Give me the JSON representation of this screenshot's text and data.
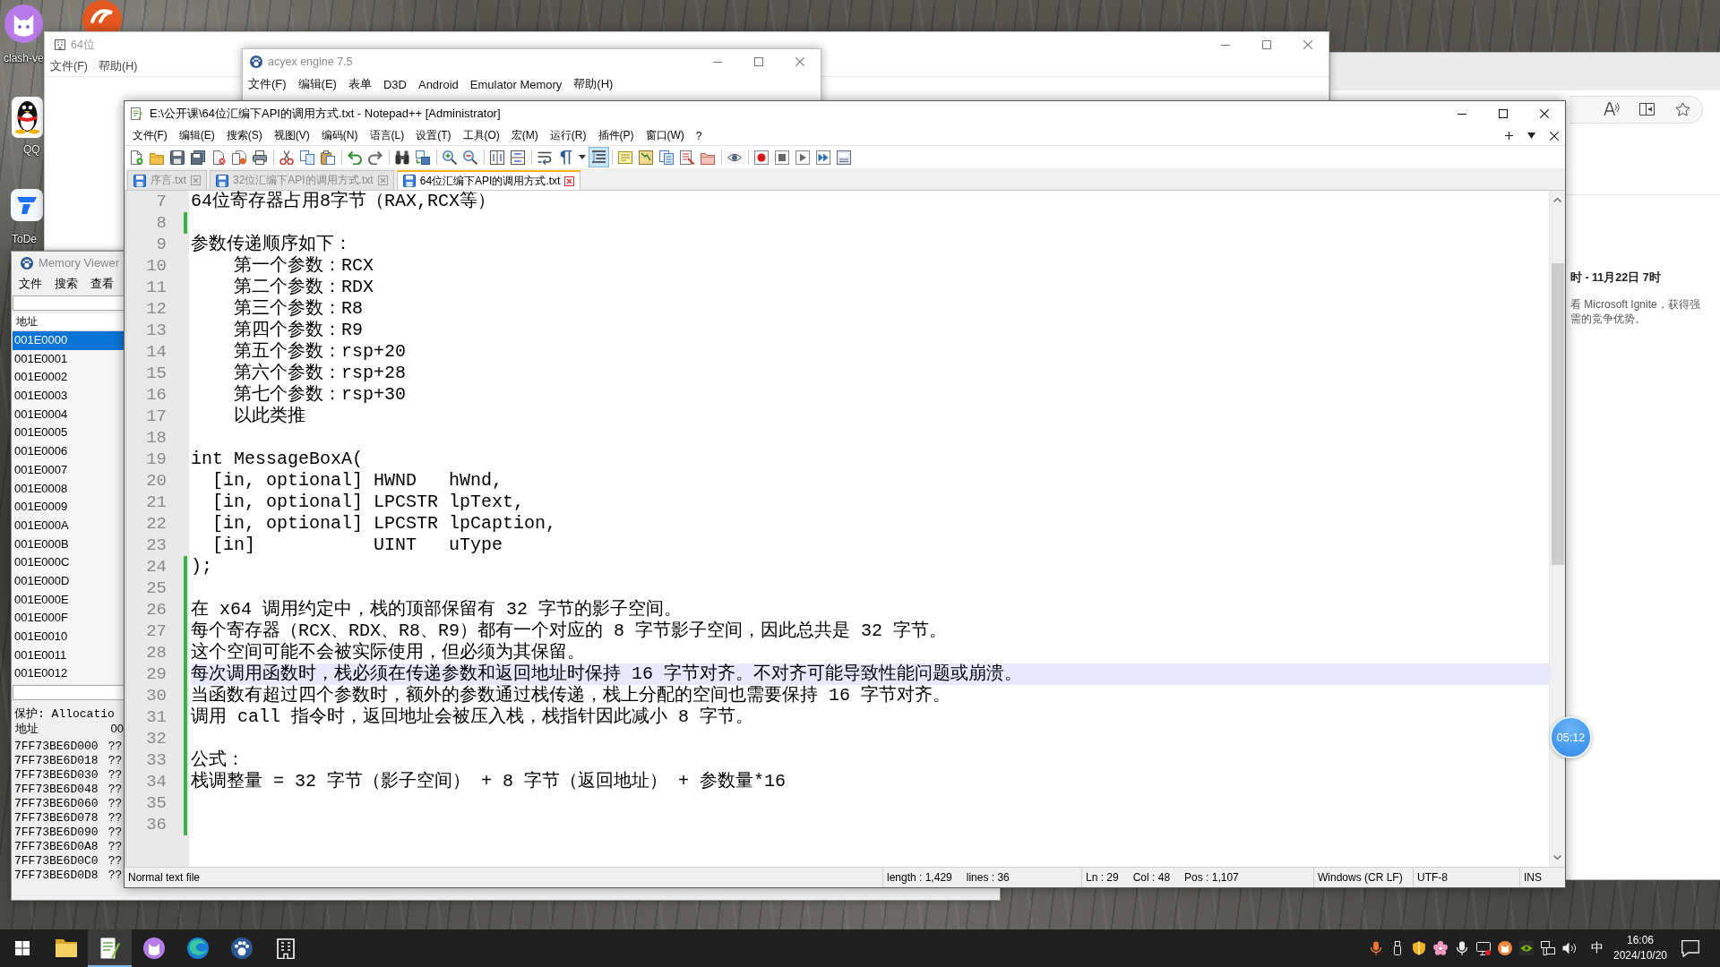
{
  "desktop_icons": [
    {
      "kind": "cat",
      "label": "clash-ve"
    },
    {
      "kind": "swirl"
    },
    {
      "kind": "penguin",
      "label": "QQ"
    },
    {
      "kind": "tile",
      "label": "ToDe"
    }
  ],
  "back_window": {
    "title": "64位",
    "menu": [
      "文件(F)",
      "帮助(H)"
    ]
  },
  "engine_window": {
    "title": "acyex engine 7.5",
    "menu": [
      "文件(F)",
      "编辑(E)",
      "表单",
      "D3D",
      "Android",
      "Emulator Memory",
      "帮助(H)"
    ]
  },
  "browser": {
    "event_title": "时 - 11月22日 7时",
    "event_lines": [
      "看 Microsoft Ignite，获得强",
      "需的竞争优势。"
    ]
  },
  "memory_viewer": {
    "title": "Memory Viewer",
    "menu": [
      "文件",
      "搜索",
      "查看"
    ],
    "list_header": "地址",
    "addresses": [
      {
        "address": "001E0000",
        "selected": true
      },
      {
        "address": "001E0001",
        "selected": false
      },
      {
        "address": "001E0002",
        "selected": false
      },
      {
        "address": "001E0003",
        "selected": false
      },
      {
        "address": "001E0004",
        "selected": false
      },
      {
        "address": "001E0005",
        "selected": false
      },
      {
        "address": "001E0006",
        "selected": false
      },
      {
        "address": "001E0007",
        "selected": false
      },
      {
        "address": "001E0008",
        "selected": false
      },
      {
        "address": "001E0009",
        "selected": false
      },
      {
        "address": "001E000A",
        "selected": false
      },
      {
        "address": "001E000B",
        "selected": false
      },
      {
        "address": "001E000C",
        "selected": false
      },
      {
        "address": "001E000D",
        "selected": false
      },
      {
        "address": "001E000E",
        "selected": false
      },
      {
        "address": "001E000F",
        "selected": false
      },
      {
        "address": "001E0010",
        "selected": false
      },
      {
        "address": "001E0011",
        "selected": false
      },
      {
        "address": "001E0012",
        "selected": false
      }
    ],
    "protection": "保护: Allocatio",
    "hex_header": [
      "地址",
      "00"
    ],
    "hex_rows": [
      {
        "address": "7FF73BE6D000",
        "value": "??"
      },
      {
        "address": "7FF73BE6D018",
        "value": "??"
      },
      {
        "address": "7FF73BE6D030",
        "value": "??"
      },
      {
        "address": "7FF73BE6D048",
        "value": "??"
      },
      {
        "address": "7FF73BE6D060",
        "value": "??"
      },
      {
        "address": "7FF73BE6D078",
        "value": "??"
      },
      {
        "address": "7FF73BE6D090",
        "value": "??"
      },
      {
        "address": "7FF73BE6D0A8",
        "value": "??"
      },
      {
        "address": "7FF73BE6D0C0",
        "value": "??"
      },
      {
        "address": "7FF73BE6D0D8",
        "value": "??"
      }
    ]
  },
  "notepad": {
    "title": "E:\\公开课\\64位汇编下API的调用方式.txt - Notepad++ [Administrator]",
    "menu": [
      "文件(F)",
      "编辑(E)",
      "搜索(S)",
      "视图(V)",
      "编码(N)",
      "语言(L)",
      "设置(T)",
      "工具(O)",
      "宏(M)",
      "运行(R)",
      "插件(P)",
      "窗口(W)",
      "?"
    ],
    "toolbar": [
      [
        {
          "kind": "new",
          "pressed": false
        },
        {
          "kind": "open",
          "pressed": false
        },
        {
          "kind": "save",
          "pressed": false
        },
        {
          "kind": "save_all",
          "pressed": false
        },
        {
          "kind": "close",
          "pressed": false
        },
        {
          "kind": "close_all",
          "pressed": false
        },
        {
          "kind": "print",
          "pressed": false
        }
      ],
      [
        {
          "kind": "cut",
          "pressed": false
        },
        {
          "kind": "copy",
          "pressed": false
        },
        {
          "kind": "paste",
          "pressed": false
        }
      ],
      [
        {
          "kind": "undo",
          "pressed": false
        },
        {
          "kind": "redo",
          "pressed": false
        }
      ],
      [
        {
          "kind": "find",
          "pressed": false
        },
        {
          "kind": "replace",
          "pressed": false
        }
      ],
      [
        {
          "kind": "zoom_in",
          "pressed": false
        },
        {
          "kind": "zoom_out",
          "pressed": false
        }
      ],
      [
        {
          "kind": "sync_vertical",
          "pressed": false
        },
        {
          "kind": "sync_horizontal",
          "pressed": false
        }
      ],
      [
        {
          "kind": "word_wrap",
          "pressed": false
        },
        {
          "kind": "all_chars",
          "pressed": false
        },
        {
          "kind": "dropdown",
          "pressed": false
        },
        {
          "kind": "indent_guide",
          "pressed": true
        }
      ],
      [
        {
          "kind": "language",
          "pressed": false
        },
        {
          "kind": "doc_map",
          "pressed": false
        },
        {
          "kind": "doc_list",
          "pressed": false
        },
        {
          "kind": "function_list",
          "pressed": false
        },
        {
          "kind": "folder_workspace",
          "pressed": false
        }
      ],
      [
        {
          "kind": "monitor",
          "pressed": false
        }
      ],
      [
        {
          "kind": "record",
          "pressed": false
        },
        {
          "kind": "stop",
          "pressed": false
        },
        {
          "kind": "play",
          "pressed": false
        },
        {
          "kind": "play_multi",
          "pressed": false
        },
        {
          "kind": "save_macro",
          "pressed": false
        }
      ]
    ],
    "tabs": [
      {
        "label": "序言.txt",
        "selected": false
      },
      {
        "label": "32位汇编下API的调用方式.txt",
        "selected": false
      },
      {
        "label": "64位汇编下API的调用方式.txt",
        "selected": true
      }
    ],
    "lines": [
      {
        "number": "7",
        "text": "64位寄存器占用8字节（RAX,RCX等）",
        "changed": false,
        "current": false
      },
      {
        "number": "8",
        "changed": true,
        "current": false
      },
      {
        "number": "9",
        "text": "参数传递顺序如下：",
        "changed": false,
        "current": false
      },
      {
        "number": "10",
        "text": "    第一个参数：RCX",
        "changed": false,
        "current": false
      },
      {
        "number": "11",
        "text": "    第二个参数：RDX",
        "changed": false,
        "current": false
      },
      {
        "number": "12",
        "text": "    第三个参数：R8",
        "changed": false,
        "current": false
      },
      {
        "number": "13",
        "text": "    第四个参数：R9",
        "changed": false,
        "current": false
      },
      {
        "number": "14",
        "text": "    第五个参数：rsp+20",
        "changed": false,
        "current": false
      },
      {
        "number": "15",
        "text": "    第六个参数：rsp+28",
        "changed": false,
        "current": false
      },
      {
        "number": "16",
        "text": "    第七个参数：rsp+30",
        "changed": false,
        "current": false
      },
      {
        "number": "17",
        "text": "    以此类推",
        "changed": false,
        "current": false
      },
      {
        "number": "18",
        "changed": false,
        "current": false
      },
      {
        "number": "19",
        "text": "int MessageBoxA(",
        "changed": false,
        "current": false
      },
      {
        "number": "20",
        "text": "  [in, optional] HWND   hWnd,",
        "changed": false,
        "current": false
      },
      {
        "number": "21",
        "text": "  [in, optional] LPCSTR lpText,",
        "changed": false,
        "current": false
      },
      {
        "number": "22",
        "text": "  [in, optional] LPCSTR lpCaption,",
        "changed": false,
        "current": false
      },
      {
        "number": "23",
        "text": "  [in]           UINT   uType",
        "changed": false,
        "current": false
      },
      {
        "number": "24",
        "text": ");",
        "changed": true,
        "current": false
      },
      {
        "number": "25",
        "changed": true,
        "current": false
      },
      {
        "number": "26",
        "text": "在 x64 调用约定中，栈的顶部保留有 32 字节的影子空间。",
        "changed": true,
        "current": false
      },
      {
        "number": "27",
        "text": "每个寄存器（RCX、RDX、R8、R9）都有一个对应的 8 字节影子空间，因此总共是 32 字节。",
        "changed": true,
        "current": false
      },
      {
        "number": "28",
        "text": "这个空间可能不会被实际使用，但必须为其保留。",
        "changed": true,
        "current": false
      },
      {
        "number": "29",
        "text": "每次调用函数时，栈必须在传递参数和返回地址时保持 16 字节对齐。不对齐可能导致性能问题或崩溃。",
        "changed": true,
        "current": true
      },
      {
        "number": "30",
        "text": "当函数有超过四个参数时，额外的参数通过栈传递，栈上分配的空间也需要保持 16 字节对齐。",
        "changed": true,
        "current": false
      },
      {
        "number": "31",
        "text": "调用 call 指令时，返回地址会被压入栈，栈指针因此减小 8 字节。",
        "changed": true,
        "current": false
      },
      {
        "number": "32",
        "changed": true,
        "current": false
      },
      {
        "number": "33",
        "text": "公式：",
        "changed": true,
        "current": false
      },
      {
        "number": "34",
        "text": "栈调整量 = 32 字节（影子空间） + 8 字节（返回地址） + 参数量*16",
        "changed": true,
        "current": false
      },
      {
        "number": "35",
        "changed": true,
        "current": false
      },
      {
        "number": "36",
        "changed": true,
        "current": false
      }
    ],
    "status": {
      "file_type": "Normal text file",
      "length": "length : 1,429",
      "lines": "lines : 36",
      "line": "Ln : 29",
      "column": "Col : 48",
      "position": "Pos : 1,107",
      "line_ending": "Windows (CR LF)",
      "encoding": "UTF-8",
      "mode": "INS"
    }
  },
  "timer": "05:12",
  "taskbar": {
    "apps": [
      {
        "kind": "folder",
        "active": false
      },
      {
        "kind": "notepad",
        "active": true
      },
      {
        "kind": "cat",
        "active": false
      },
      {
        "kind": "browser",
        "active": false
      },
      {
        "kind": "paw",
        "active": false
      },
      {
        "kind": "building",
        "active": false
      }
    ],
    "ime": "中",
    "time": "16:06",
    "date": "2024/10/20"
  }
}
